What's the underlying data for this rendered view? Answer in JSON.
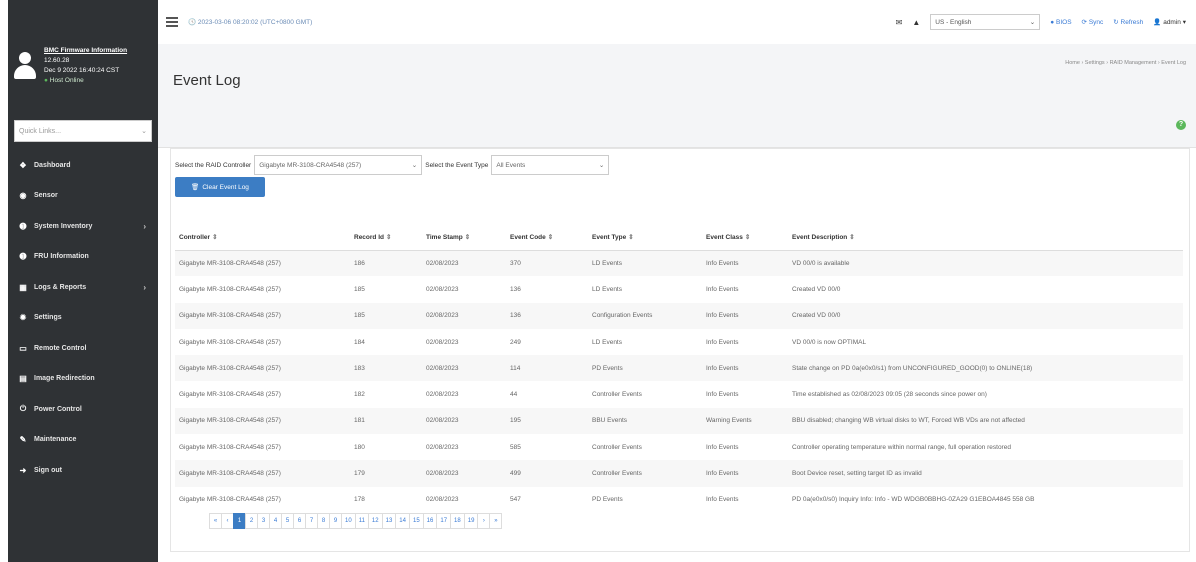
{
  "sidebar": {
    "profile": {
      "title": "BMC Firmware Information",
      "version": "12.60.28",
      "build_date": "Dec 9 2022 16:40:24 CST",
      "status": "Host Online"
    },
    "quick_links": {
      "placeholder": "Quick Links..."
    },
    "items": [
      {
        "label": "Dashboard",
        "icon": "dashboard-icon",
        "glyph": "❖",
        "has_caret": false
      },
      {
        "label": "Sensor",
        "icon": "sensor-icon",
        "glyph": "◉",
        "has_caret": false
      },
      {
        "label": "System Inventory",
        "icon": "info-icon",
        "glyph": "➊",
        "has_caret": true
      },
      {
        "label": "FRU Information",
        "icon": "info-icon",
        "glyph": "➊",
        "has_caret": false
      },
      {
        "label": "Logs & Reports",
        "icon": "chart-icon",
        "glyph": "▦",
        "has_caret": true
      },
      {
        "label": "Settings",
        "icon": "gear-icon",
        "glyph": "✹",
        "has_caret": false
      },
      {
        "label": "Remote Control",
        "icon": "monitor-icon",
        "glyph": "▭",
        "has_caret": false
      },
      {
        "label": "Image Redirection",
        "icon": "image-icon",
        "glyph": "▤",
        "has_caret": false
      },
      {
        "label": "Power Control",
        "icon": "power-icon",
        "glyph": "⏻",
        "has_caret": false
      },
      {
        "label": "Maintenance",
        "icon": "wrench-icon",
        "glyph": "✎",
        "has_caret": false
      },
      {
        "label": "Sign out",
        "icon": "signout-icon",
        "glyph": "➜",
        "has_caret": false
      }
    ]
  },
  "topbar": {
    "datetime": "2023-03-06 08:20:02 (UTC+0800 GMT)",
    "language": "US - English",
    "bios_label": "BIOS",
    "sync_label": "Sync",
    "refresh_label": "Refresh",
    "admin_label": "admin"
  },
  "header": {
    "title": "Event Log",
    "breadcrumb": "Home › Settings › RAID Management › Event Log"
  },
  "filters": {
    "controller_label": "Select the RAID Controller",
    "controller_value": "Gigabyte MR-3108-CRA4548 (257)",
    "event_type_label": "Select the Event Type",
    "event_type_value": "All Events",
    "clear_button": "Clear Event Log"
  },
  "table": {
    "columns": [
      "Controller",
      "Record Id",
      "Time Stamp",
      "Event Code",
      "Event Type",
      "Event Class",
      "Event Description"
    ],
    "rows": [
      [
        "Gigabyte MR-3108-CRA4548 (257)",
        "186",
        "02/08/2023",
        "370",
        "LD Events",
        "Info Events",
        "VD 00/0 is available"
      ],
      [
        "Gigabyte MR-3108-CRA4548 (257)",
        "185",
        "02/08/2023",
        "136",
        "LD Events",
        "Info Events",
        "Created VD 00/0"
      ],
      [
        "Gigabyte MR-3108-CRA4548 (257)",
        "185",
        "02/08/2023",
        "136",
        "Configuration Events",
        "Info Events",
        "Created VD 00/0"
      ],
      [
        "Gigabyte MR-3108-CRA4548 (257)",
        "184",
        "02/08/2023",
        "249",
        "LD Events",
        "Info Events",
        "VD 00/0 is now OPTIMAL"
      ],
      [
        "Gigabyte MR-3108-CRA4548 (257)",
        "183",
        "02/08/2023",
        "114",
        "PD Events",
        "Info Events",
        "State change on PD 0a(e0x0/s1) from UNCONFIGURED_GOOD(0) to ONLINE(18)"
      ],
      [
        "Gigabyte MR-3108-CRA4548 (257)",
        "182",
        "02/08/2023",
        "44",
        "Controller Events",
        "Info Events",
        "Time established as 02/08/2023 09:05 (28 seconds since power on)"
      ],
      [
        "Gigabyte MR-3108-CRA4548 (257)",
        "181",
        "02/08/2023",
        "195",
        "BBU Events",
        "Warning Events",
        "BBU disabled; changing WB virtual disks to WT, Forced WB VDs are not affected"
      ],
      [
        "Gigabyte MR-3108-CRA4548 (257)",
        "180",
        "02/08/2023",
        "585",
        "Controller Events",
        "Info Events",
        "Controller operating temperature within normal range, full operation restored"
      ],
      [
        "Gigabyte MR-3108-CRA4548 (257)",
        "179",
        "02/08/2023",
        "499",
        "Controller Events",
        "Info Events",
        "Boot Device reset, setting target ID as invalid"
      ],
      [
        "Gigabyte MR-3108-CRA4548 (257)",
        "178",
        "02/08/2023",
        "547",
        "PD Events",
        "Info Events",
        "PD 0a(e0x0/s0) Inquiry Info: Info - WD WDGB0BBHG-0ZA29 G1EBOA4845 558 GB"
      ]
    ]
  },
  "pagination": {
    "first": "«",
    "prev": "‹",
    "pages": [
      "1",
      "2",
      "3",
      "4",
      "5",
      "6",
      "7",
      "8",
      "9",
      "10",
      "11",
      "12",
      "13",
      "14",
      "15",
      "16",
      "17",
      "18",
      "19"
    ],
    "next": "›",
    "last": "»",
    "active": "1"
  },
  "colors": {
    "sidebar_bg": "#2f3235",
    "accent": "#3c7dc4",
    "online": "#5cb85c"
  }
}
